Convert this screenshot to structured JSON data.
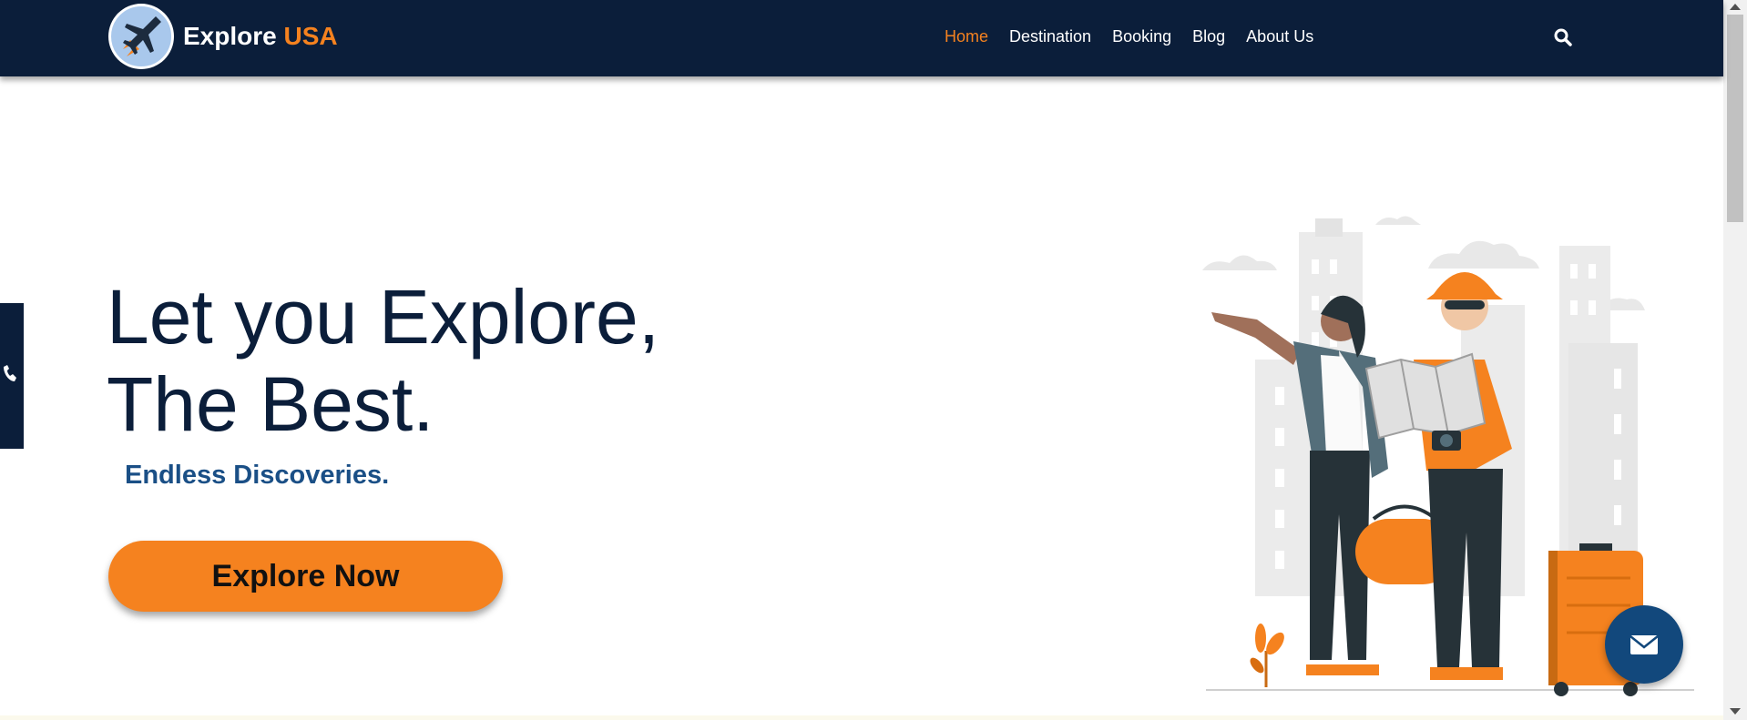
{
  "brand": {
    "name_part1": "Explore",
    "name_part2": "USA"
  },
  "nav": {
    "items": [
      {
        "label": "Home",
        "active": true
      },
      {
        "label": "Destination",
        "active": false
      },
      {
        "label": "Booking",
        "active": false
      },
      {
        "label": "Blog",
        "active": false
      },
      {
        "label": "About Us",
        "active": false
      }
    ],
    "search_icon": "search-icon"
  },
  "hero": {
    "title_line1": "Let you Explore,",
    "title_line2": "The Best.",
    "subtitle": "Endless Discoveries.",
    "cta_label": "Explore Now"
  },
  "side_tab": {
    "icon": "phone-icon"
  },
  "floating": {
    "icon": "envelope-icon"
  },
  "colors": {
    "navy": "#0b1e3a",
    "accent_orange": "#f5821f",
    "subtitle_blue": "#1a4f86",
    "mail_button": "#12487c"
  }
}
